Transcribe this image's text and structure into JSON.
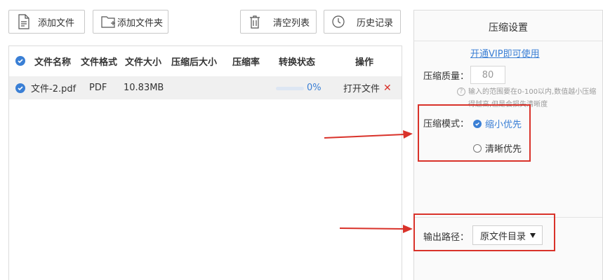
{
  "toolbar": {
    "add_file": "添加文件",
    "add_folder": "添加文件夹",
    "clear_list": "清空列表",
    "history": "历史记录"
  },
  "table": {
    "columns": [
      "文件名称",
      "文件格式",
      "文件大小",
      "压缩后大小",
      "压缩率",
      "转换状态",
      "操作"
    ],
    "rows": [
      {
        "name": "文件-2.pdf",
        "format": "PDF",
        "size": "10.83MB",
        "compressed_size": "",
        "ratio": "",
        "progress_label": "0%",
        "progress_fraction": 0,
        "action": "打开文件",
        "delete_symbol": "✕"
      }
    ]
  },
  "settings": {
    "title": "压缩设置",
    "vip_link": "开通VIP即可使用",
    "quality_label": "压缩质量：",
    "quality_value": "80",
    "hint": "输入的范围要在0-100以内,数值越小压缩得越高,但是会损失清晰度",
    "hint_icon": "?",
    "mode_label": "压缩模式：",
    "mode_options": [
      "缩小优先",
      "清晰优先"
    ],
    "mode_selected": "缩小优先",
    "output_label": "输出路径：",
    "output_value": "原文件目录"
  },
  "colors": {
    "accent": "#3a7fd5",
    "annotation_red": "#d9322a"
  },
  "icons": {
    "add_file": "add-file-icon",
    "add_folder": "add-folder-icon",
    "clear_list": "trash-icon",
    "history": "clock-icon"
  }
}
